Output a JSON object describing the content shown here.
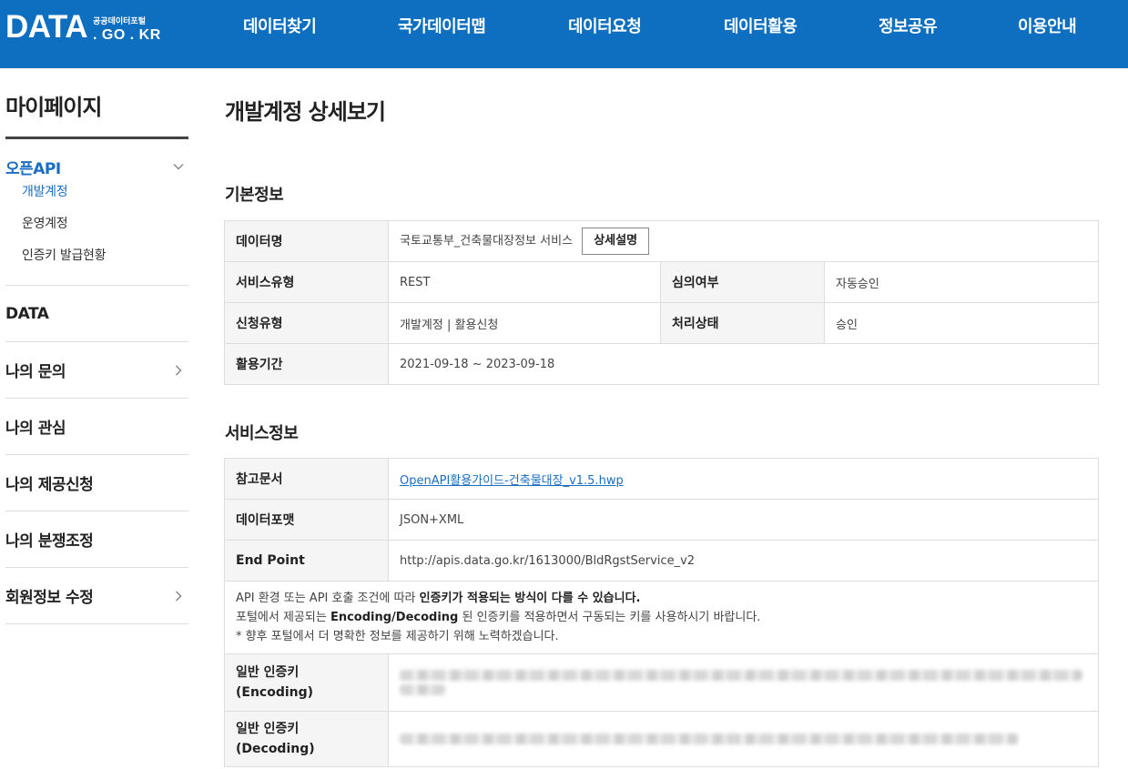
{
  "header": {
    "logo_main": "DATA",
    "logo_sub": "공공데이터포털",
    "logo_domain": ". GO . KR",
    "nav": [
      "데이터찾기",
      "국가데이터맵",
      "데이터요청",
      "데이터활용",
      "정보공유",
      "이용안내"
    ],
    "background_color": "#0e6fc0"
  },
  "sidebar": {
    "title": "마이페이지",
    "groups": [
      {
        "label": "오픈API",
        "icon": "chevron-down-icon",
        "sub": [
          "개발계정",
          "운영계정",
          "인증키 발급현황"
        ]
      },
      {
        "label": "DATA"
      },
      {
        "label": "나의 문의",
        "icon": "chevron-right-icon"
      },
      {
        "label": "나의 관심"
      },
      {
        "label": "나의 제공신청"
      },
      {
        "label": "나의 분쟁조정"
      },
      {
        "label": "회원정보 수정",
        "icon": "chevron-right-icon"
      }
    ],
    "accent_color": "#1a6ec4"
  },
  "main": {
    "title": "개발계정 상세보기",
    "basic": {
      "title": "기본정보",
      "data_name_label": "데이터명",
      "data_name": "국토교통부_건축물대장정보 서비스",
      "detail_button": "상세설명",
      "service_type_label": "서비스유형",
      "service_type": "REST",
      "review_label": "심의여부",
      "review": "자동승인",
      "apply_type_label": "신청유형",
      "apply_type": "개발계정 | 활용신청",
      "status_label": "처리상태",
      "status": "승인",
      "period_label": "활용기간",
      "period": "2021-09-18 ~ 2023-09-18"
    },
    "service": {
      "title": "서비스정보",
      "doc_label": "참고문서",
      "doc_link": "OpenAPI활용가이드-건축물대장_v1.5.hwp",
      "format_label": "데이터포맷",
      "format": "JSON+XML",
      "endpoint_label": "End Point",
      "endpoint": "http://apis.data.go.kr/1613000/BldRgstService_v2",
      "notice1_pre": "API 환경 또는 API 호출 조건에 따라 ",
      "notice1_bold": "인증키가 적용되는 방식이 다를 수 있습니다.",
      "notice2_pre": "포털에서 제공되는 ",
      "notice2_bold": "Encoding/Decoding",
      "notice2_post": " 된 인증키를 적용하면서 구동되는 키를 사용하시기 바랍니다.",
      "notice3": "* 향후 포털에서 더 명확한 정보를 제공하기 위해 노력하겠습니다.",
      "enc_label1": "일반 인증키",
      "enc_label2": "(Encoding)",
      "dec_label1": "일반 인증키",
      "dec_label2": "(Decoding)"
    }
  }
}
